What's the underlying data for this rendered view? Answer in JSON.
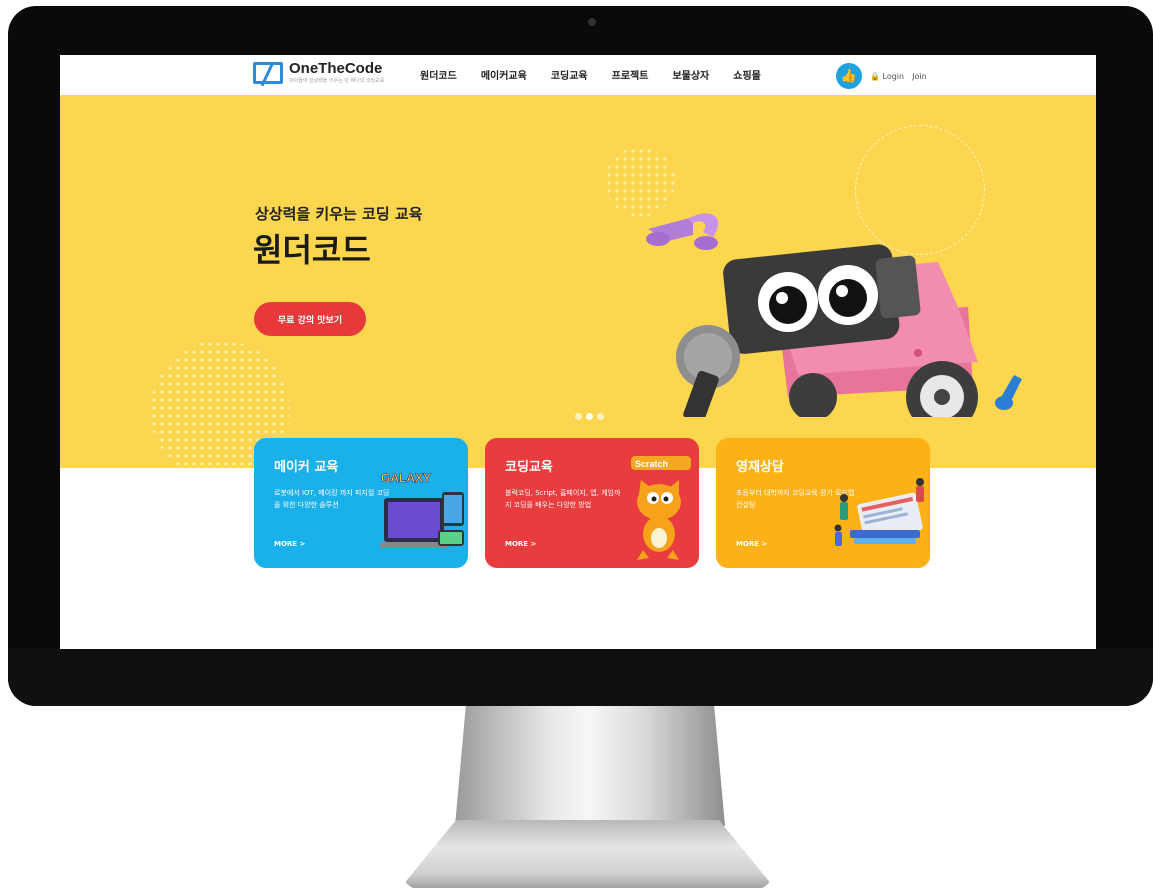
{
  "header": {
    "logo_text": "OneTheCode",
    "logo_sub": "아이들의 상상력을 키우는 단 하나의 코딩교육",
    "nav": [
      "원더코드",
      "메이커교육",
      "코딩교육",
      "프로젝트",
      "보물상자",
      "쇼핑몰"
    ],
    "login": "Login",
    "join": "Join"
  },
  "hero": {
    "subtitle": "상상력을 키우는 코딩 교육",
    "title": "원더코드",
    "cta": "무료 강의 맛보기"
  },
  "cards": [
    {
      "title": "메이커 교육",
      "desc": "로봇에서 IOT, 메이킹 까지 피지컬 코딩을 위한 다양한 솔루션",
      "more": "MORE >",
      "badge": "GALAXY",
      "color": "#1ab0ea"
    },
    {
      "title": "코딩교육",
      "desc": "블럭코딩, Script, 홈페이지, 앱, 게임까지 코딩을 배우는 다양한 방법",
      "more": "MORE >",
      "badge": "Scratch",
      "color": "#e83c3f"
    },
    {
      "title": "영재상담",
      "desc": "초등부터 대학까지 코딩교육 장기 로드맵 컨설팅",
      "more": "MORE >",
      "color": "#fcb116"
    }
  ],
  "colors": {
    "hero_bg": "#fcd64e",
    "cta": "#e8393a",
    "accent": "#1fa3e0"
  }
}
